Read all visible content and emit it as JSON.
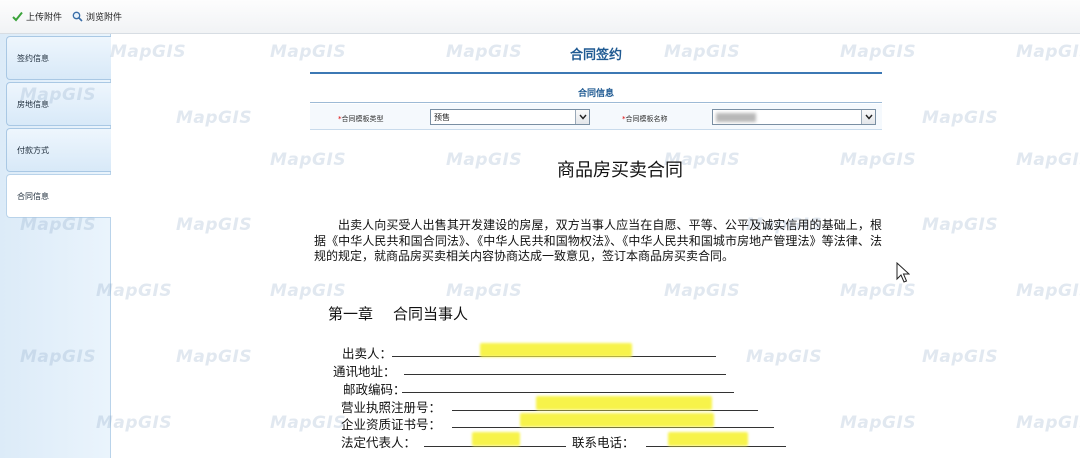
{
  "toolbar": {
    "upload_label": "上传附件",
    "browse_label": "浏览附件"
  },
  "sidebar": {
    "items": [
      {
        "label": "签约信息",
        "active": false
      },
      {
        "label": "房地信息",
        "active": false
      },
      {
        "label": "付款方式",
        "active": false
      },
      {
        "label": "合同信息",
        "active": true
      }
    ]
  },
  "watermark": "MapGIS",
  "header": {
    "title": "合同签约",
    "section_title": "合同信息"
  },
  "form": {
    "template_type": {
      "label": "合同模板类型",
      "value": "预售"
    },
    "template_name": {
      "label": "合同模板名称",
      "value": ""
    }
  },
  "contract": {
    "title": "商品房买卖合同",
    "preamble": "出卖人向买受人出售其开发建设的房屋，双方当事人应当在自愿、平等、公平及诚实信用的基础上，根据《中华人民共和国合同法》、《中华人民共和国物权法》、《中华人民共和国城市房地产管理法》等法律、法规的规定，就商品房买卖相关内容协商达成一致意见，签订本商品房买卖合同。",
    "chapter_no": "第一章",
    "chapter_title": "合同当事人",
    "fields": {
      "seller": "出卖人：",
      "address": "通讯地址：",
      "postcode": "邮政编码：",
      "license_no": "营业执照注册号：",
      "qualification_no": "企业资质证书号：",
      "legal_rep": "法定代表人：",
      "phone": "联系电话："
    }
  },
  "colors": {
    "accent": "#1f5a92",
    "sidebar_bg": "#dcebf8",
    "highlight": "#f7f34a"
  }
}
